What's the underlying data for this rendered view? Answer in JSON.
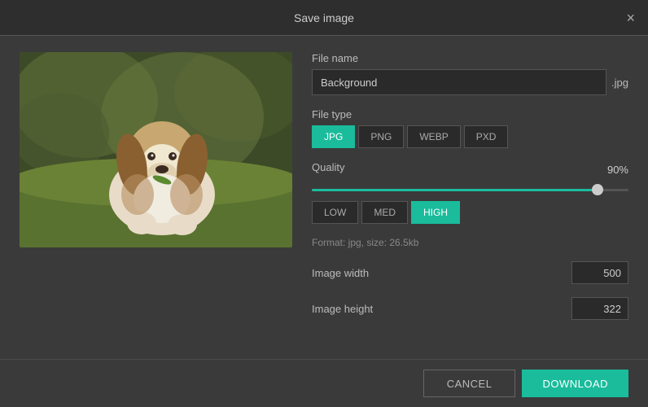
{
  "modal": {
    "title": "Save image",
    "close_icon": "×"
  },
  "form": {
    "file_name_label": "File name",
    "file_name_value": "Background",
    "file_ext": ".jpg",
    "file_type_label": "File type",
    "file_types": [
      {
        "label": "JPG",
        "active": true
      },
      {
        "label": "PNG",
        "active": false
      },
      {
        "label": "WEBP",
        "active": false
      },
      {
        "label": "PXD",
        "active": false
      }
    ],
    "quality_label": "Quality",
    "quality_value": "90%",
    "quality_levels": [
      {
        "label": "LOW",
        "active": false
      },
      {
        "label": "MED",
        "active": false
      },
      {
        "label": "HIGH",
        "active": true
      }
    ],
    "format_info": "Format: jpg, size: 26.5kb",
    "image_width_label": "Image width",
    "image_width_value": "500",
    "image_height_label": "Image height",
    "image_height_value": "322"
  },
  "footer": {
    "cancel_label": "CANCEL",
    "download_label": "DOWNLOAD"
  }
}
